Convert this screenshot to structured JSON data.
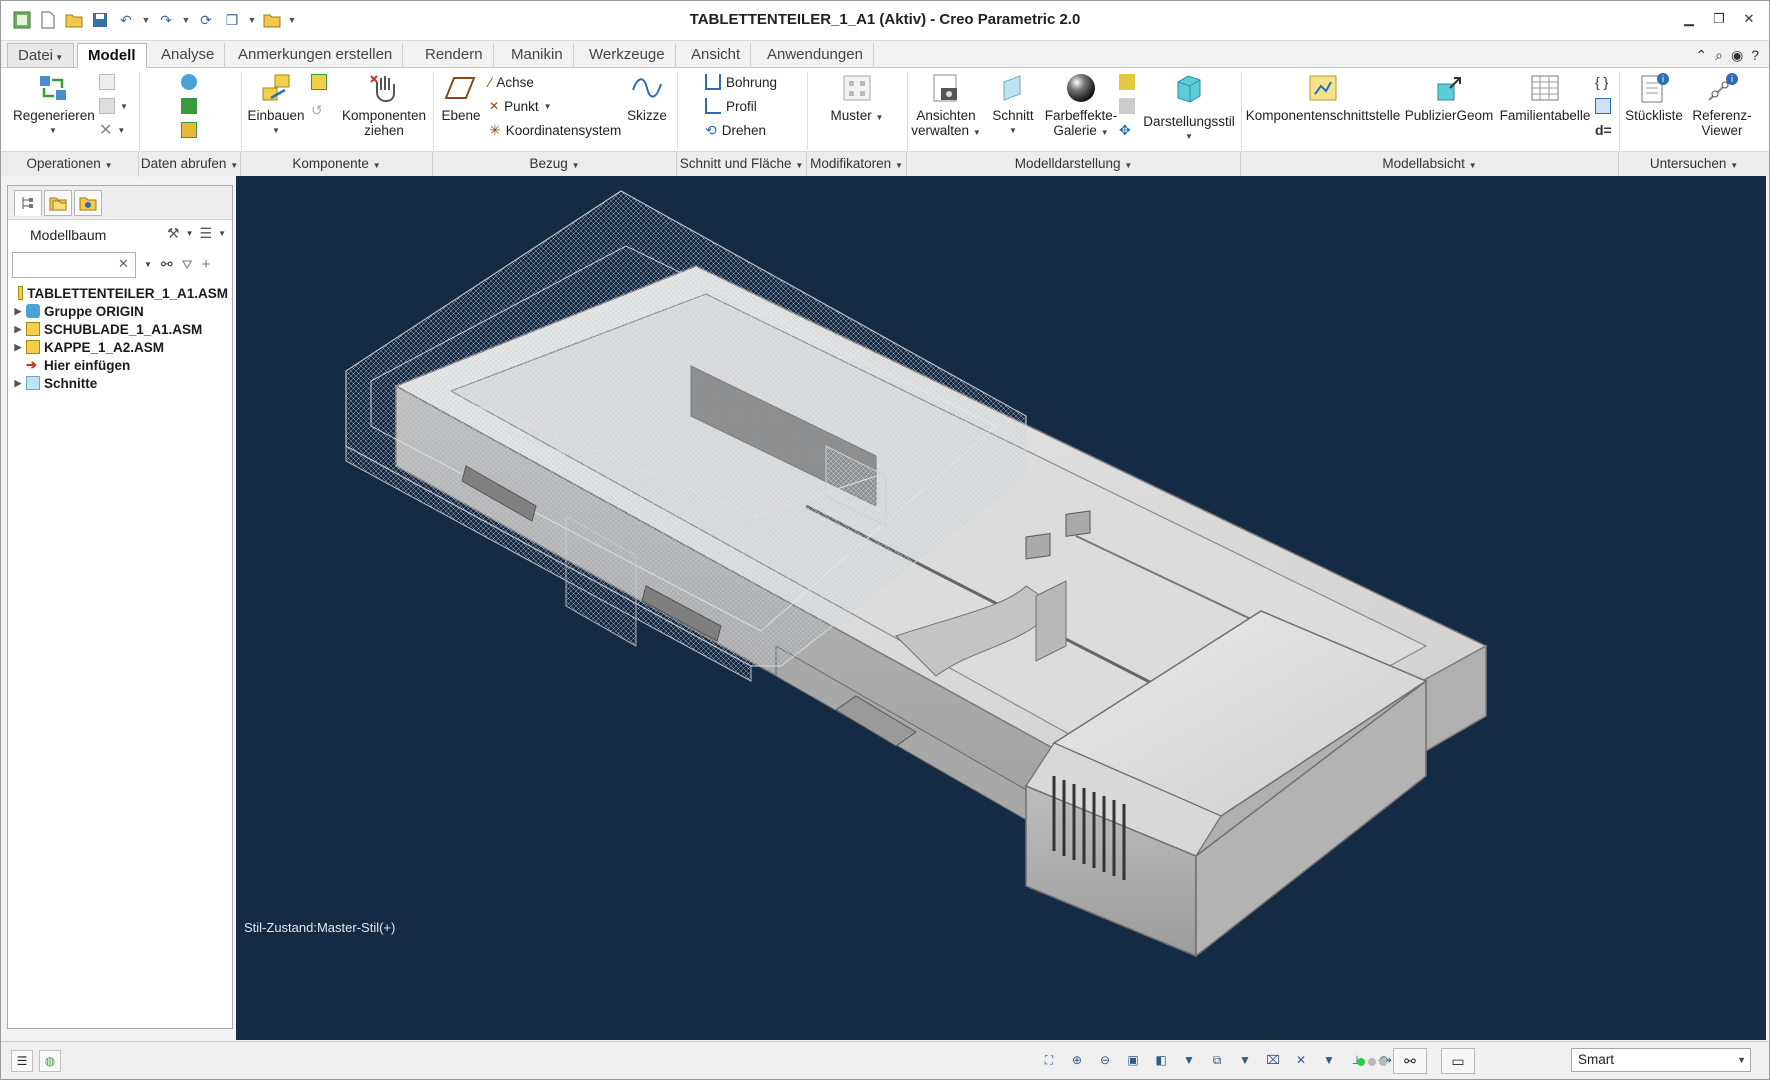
{
  "window": {
    "title": "TABLETTENTEILER_1_A1 (Aktiv) - Creo Parametric 2.0",
    "controls": [
      "minimize",
      "restore",
      "close"
    ]
  },
  "tabs": [
    {
      "label": "Datei",
      "dropdown": true
    },
    {
      "label": "Modell",
      "active": true
    },
    {
      "label": "Analyse"
    },
    {
      "label": "Anmerkungen erstellen"
    },
    {
      "label": "Rendern"
    },
    {
      "label": "Manikin"
    },
    {
      "label": "Werkzeuge"
    },
    {
      "label": "Ansicht"
    },
    {
      "label": "Anwendungen"
    }
  ],
  "ribbon": {
    "operationen": {
      "regenerieren": "Regenerieren",
      "label": "Operationen"
    },
    "daten_abrufen": {
      "label": "Daten abrufen"
    },
    "komponente": {
      "einbauen": "Einbauen",
      "komponenten_ziehen_1": "Komponenten",
      "komponenten_ziehen_2": "ziehen",
      "label": "Komponente"
    },
    "bezug": {
      "ebene": "Ebene",
      "achse": "Achse",
      "punkt": "Punkt",
      "koordinatensystem": "Koordinatensystem",
      "skizze": "Skizze",
      "label": "Bezug"
    },
    "schnitt_flaeche": {
      "bohrung": "Bohrung",
      "profil": "Profil",
      "drehen": "Drehen",
      "label": "Schnitt und Fläche"
    },
    "modifikatoren": {
      "muster": "Muster",
      "label": "Modifikatoren"
    },
    "modelldarstellung": {
      "ansichten_1": "Ansichten",
      "ansichten_2": "verwalten",
      "schnitt": "Schnitt",
      "farbeffekte_1": "Farbeffekte-",
      "farbeffekte_2": "Galerie",
      "darstellungsstil": "Darstellungsstil",
      "label": "Modelldarstellung"
    },
    "modellabsicht": {
      "komponentenschnittstelle": "Komponentenschnittstelle",
      "publiziergeom": "PublizierGeom",
      "familientabelle": "Familientabelle",
      "label": "Modellabsicht"
    },
    "untersuchen": {
      "stueckliste": "Stückliste",
      "referenz_1": "Referenz-",
      "referenz_2": "Viewer",
      "label": "Untersuchen"
    }
  },
  "modelltree": {
    "title": "Modellbaum",
    "search_value": "",
    "items": [
      {
        "label": "TABLETTENTEILER_1_A1.ASM",
        "expand": ""
      },
      {
        "label": "Gruppe ORIGIN",
        "expand": "▶"
      },
      {
        "label": "SCHUBLADE_1_A1.ASM",
        "expand": "▶"
      },
      {
        "label": "KAPPE_1_A2.ASM",
        "expand": "▶"
      },
      {
        "label": "Hier einfügen",
        "expand": ""
      },
      {
        "label": "Schnitte",
        "expand": "▶"
      }
    ]
  },
  "viewport": {
    "status_text": "Stil-Zustand:Master-Stil(+)",
    "background": "#152a43"
  },
  "statusbar": {
    "selection_filter": "Smart",
    "dot_colors": [
      "#2ecc40",
      "#b8b8b8",
      "#b8b8b8"
    ]
  },
  "colors": {
    "accent": "#3a6ea5",
    "viewport_bg": "#152a43"
  }
}
